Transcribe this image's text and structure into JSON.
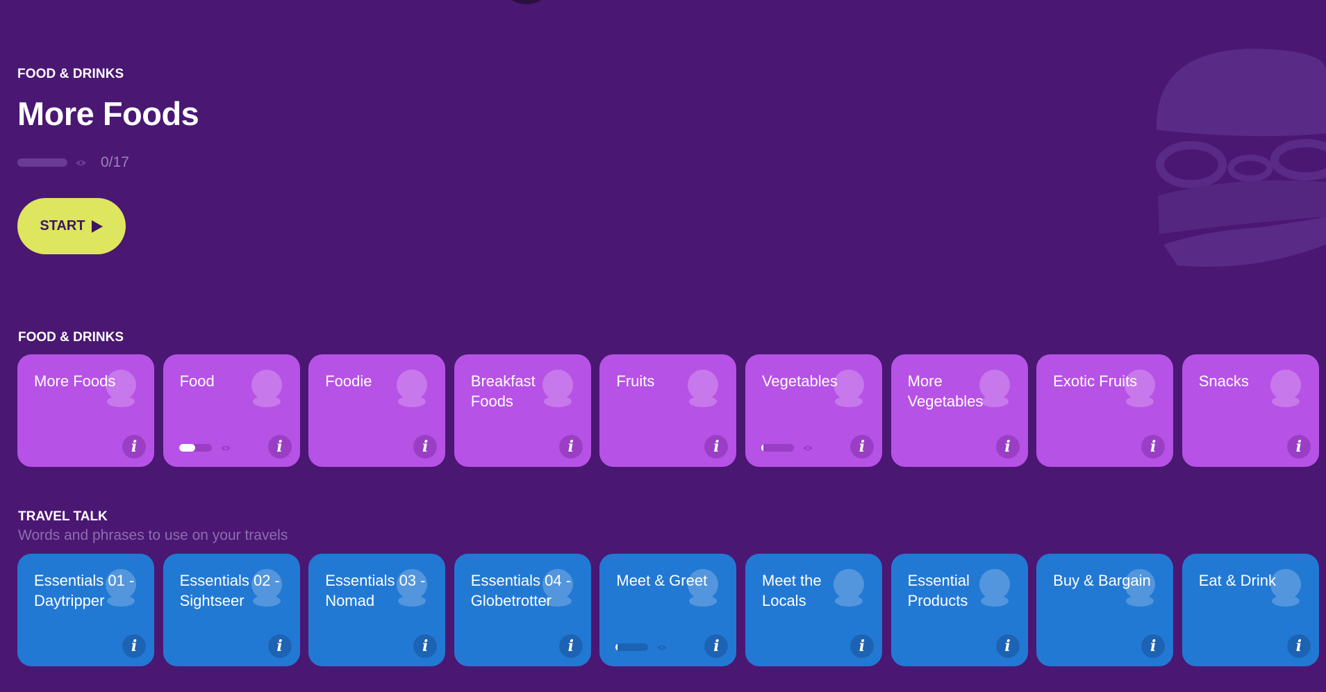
{
  "hero": {
    "category": "FOOD & DRINKS",
    "title": "More Foods",
    "progress_fraction": 0,
    "progress_text": "0/17",
    "start_label": "START",
    "background_art": "burger-illustration"
  },
  "sections": [
    {
      "label": "FOOD & DRINKS",
      "subtitle": "",
      "color": "#b752e6",
      "cards": [
        {
          "title": "More Foods",
          "icon": "burger-icon",
          "progress": null
        },
        {
          "title": "Food",
          "icon": "food-items-icon",
          "progress": 0.5
        },
        {
          "title": "Foodie",
          "icon": "dining-plate-icon",
          "progress": null
        },
        {
          "title": "Breakfast Foods",
          "icon": "cereal-bowl-icon",
          "progress": null
        },
        {
          "title": "Fruits",
          "icon": "strawberry-icon",
          "progress": null
        },
        {
          "title": "Vegetables",
          "icon": "cabbage-icon",
          "progress": 0.05
        },
        {
          "title": "More Vegetables",
          "icon": "artichoke-icon",
          "progress": null
        },
        {
          "title": "Exotic Fruits",
          "icon": "dragon-fruit-icon",
          "progress": null
        },
        {
          "title": "Snacks",
          "icon": "nachos-icon",
          "progress": null
        }
      ]
    },
    {
      "label": "TRAVEL TALK",
      "subtitle": "Words and phrases to use on your travels",
      "color": "#2279d4",
      "cards": [
        {
          "title": "Essentials 01 - Daytripper",
          "icon": "person-speech-icon",
          "progress": null
        },
        {
          "title": "Essentials 02 - Sightseer",
          "icon": "people-talking-icon",
          "progress": null
        },
        {
          "title": "Essentials 03 - Nomad",
          "icon": "people-thinking-icon",
          "progress": null
        },
        {
          "title": "Essentials 04 - Globetrotter",
          "icon": "travelers-icon",
          "progress": null
        },
        {
          "title": "Meet & Greet",
          "icon": "handshake-icon",
          "progress": 0.05
        },
        {
          "title": "Meet the Locals",
          "icon": "person-question-icon",
          "progress": null
        },
        {
          "title": "Essential Products",
          "icon": "toiletries-icon",
          "progress": null
        },
        {
          "title": "Buy & Bargain",
          "icon": "shopper-icon",
          "progress": null
        },
        {
          "title": "Eat & Drink",
          "icon": "person-drinking-icon",
          "progress": null
        }
      ]
    }
  ],
  "info_label": "i"
}
